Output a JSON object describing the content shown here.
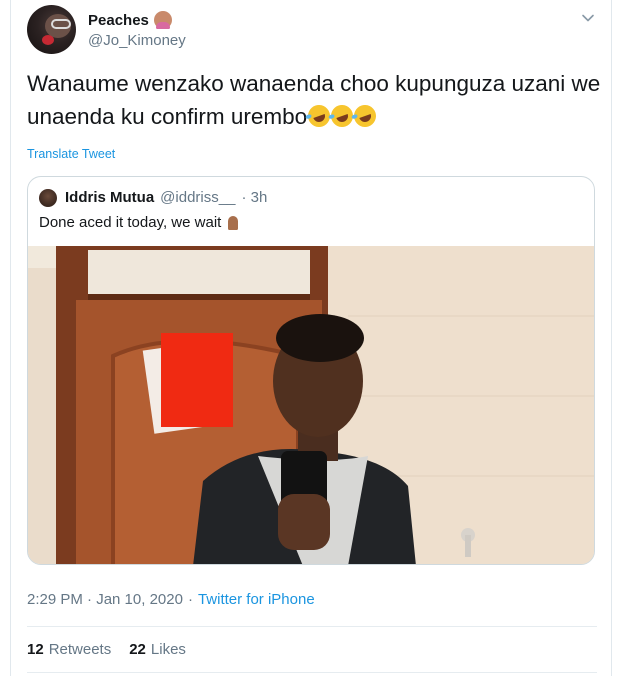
{
  "tweet": {
    "display_name": "Peaches",
    "name_emoji": "woman-tipping-hand-emoji",
    "handle": "@Jo_Kimoney",
    "text": "Wanaume wenzako wanaenda choo kupunguza uzani we unaenda ku confirm urembo",
    "text_emojis": [
      "rolling-on-floor-laughing-emoji",
      "rolling-on-floor-laughing-emoji",
      "rolling-on-floor-laughing-emoji"
    ],
    "translate_label": "Translate Tweet",
    "timestamp": "2:29 PM · Jan 10, 2020",
    "separator": "·",
    "source": "Twitter for iPhone"
  },
  "quote": {
    "name": "Iddris Mutua",
    "handle": "@iddriss__",
    "time": "· 3h",
    "text": "Done aced it today, we wait",
    "text_emoji": "folded-hands-emoji"
  },
  "engagement": {
    "retweets_count": "12",
    "retweets_label": "Retweets",
    "likes_count": "22",
    "likes_label": "Likes"
  },
  "colors": {
    "link": "#1b95e0",
    "secondary_text": "#657786",
    "primary_text": "#14171a",
    "border": "#e1e8ed"
  }
}
